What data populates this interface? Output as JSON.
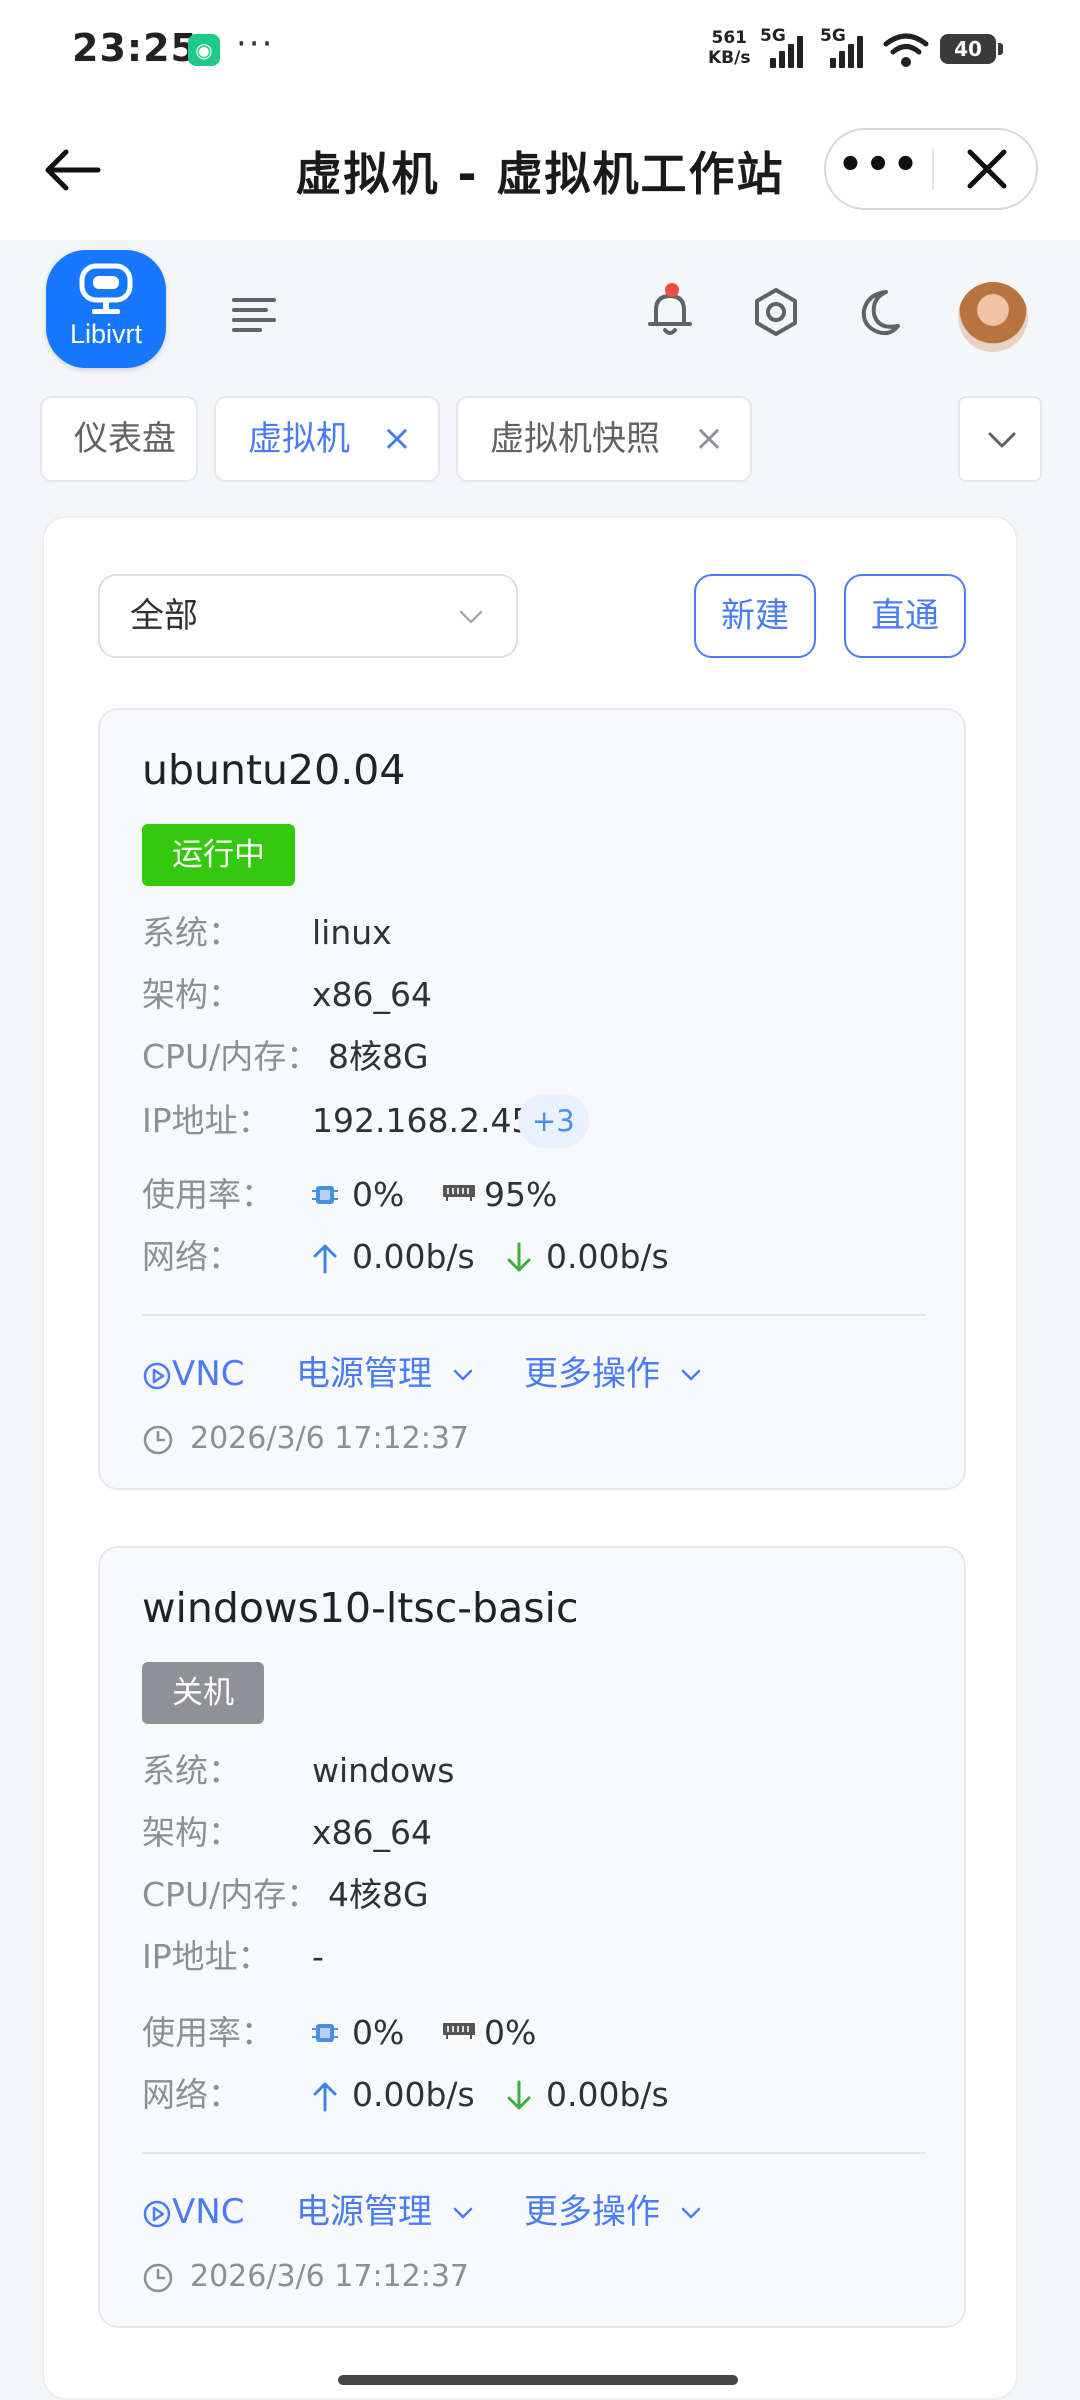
{
  "status_bar": {
    "time": "23:25",
    "speed_value": "561",
    "speed_unit": "KB/s",
    "net1": "5G",
    "net2": "5G",
    "battery": "40"
  },
  "titlebar": {
    "title": "虚拟机 - 虚拟机工作站",
    "more": "•••"
  },
  "app": {
    "logo_text": "Libivrt"
  },
  "tabs": [
    {
      "label": "仪表盘",
      "closable": false,
      "active": false
    },
    {
      "label": "虚拟机",
      "closable": true,
      "active": true
    },
    {
      "label": "虚拟机快照",
      "closable": true,
      "active": false
    }
  ],
  "tab_close_glyph": "×",
  "toolbar": {
    "filter_value": "全部",
    "new_label": "新建",
    "passthrough_label": "直通"
  },
  "labels": {
    "os": "系统：",
    "arch": "架构：",
    "cpu_mem": "CPU/内存：",
    "ip": "IP地址：",
    "usage": "使用率：",
    "network": "网络：",
    "vnc": "VNC",
    "power": "电源管理",
    "more_ops": "更多操作"
  },
  "vms": [
    {
      "name": "ubuntu20.04",
      "status": "运行中",
      "status_color": "#34c90d",
      "os": "linux",
      "arch": "x86_64",
      "cpu_mem": "8核8G",
      "ip": "192.168.2.45",
      "ip_more": "+3",
      "cpu_usage": "0%",
      "mem_usage": "95%",
      "net_up": "0.00b/s",
      "net_down": "0.00b/s",
      "time": "2026/3/6 17:12:37"
    },
    {
      "name": "windows10-ltsc-basic",
      "status": "关机",
      "status_color": "#8f9196",
      "os": "windows",
      "arch": "x86_64",
      "cpu_mem": "4核8G",
      "ip": "-",
      "cpu_usage": "0%",
      "mem_usage": "0%",
      "net_up": "0.00b/s",
      "net_down": "0.00b/s",
      "time": "2026/3/6 17:12:37"
    }
  ],
  "colors": {
    "primary": "#4a7cf5",
    "up_arrow": "#3a86e8",
    "down_arrow": "#3fae3f",
    "notification_dot": "#f04c3f"
  }
}
